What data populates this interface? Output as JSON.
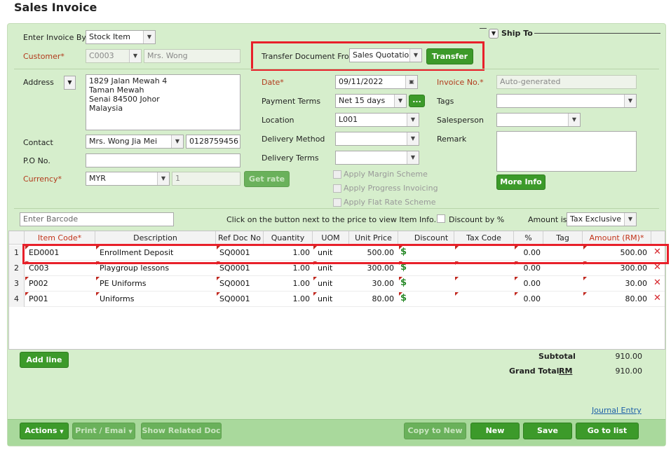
{
  "page": {
    "title": "Sales Invoice"
  },
  "header": {
    "enter_by_label": "Enter Invoice By",
    "enter_by_value": "Stock Item",
    "ship_to_label": "Ship To",
    "customer_label": "Customer*",
    "customer_code": "C0003",
    "customer_name": "Mrs. Wong",
    "transfer_label": "Transfer Document From",
    "transfer_value": "Sales Quotation",
    "transfer_button": "Transfer"
  },
  "left": {
    "address_label": "Address",
    "address_lines": [
      "1829 Jalan Mewah 4",
      "Taman Mewah",
      "Senai 84500 Johor",
      "Malaysia"
    ],
    "contact_label": "Contact",
    "contact_value": "Mrs. Wong Jia Mei",
    "phone_value": "0128759456",
    "po_label": "P.O No.",
    "po_value": "",
    "currency_label": "Currency*",
    "currency_value": "MYR",
    "rate_value": "1",
    "get_rate_button": "Get rate"
  },
  "middle": {
    "date_label": "Date*",
    "date_value": "09/11/2022",
    "payment_terms_label": "Payment Terms",
    "payment_terms_value": "Net 15 days",
    "more_button": "...",
    "location_label": "Location",
    "location_value": "L001",
    "delivery_method_label": "Delivery Method",
    "delivery_method_value": "",
    "delivery_terms_label": "Delivery Terms",
    "delivery_terms_value": "",
    "apply_margin": "Apply Margin Scheme",
    "apply_progress": "Apply Progress Invoicing",
    "apply_flat": "Apply Flat Rate Scheme"
  },
  "right": {
    "invoice_no_label": "Invoice No.*",
    "invoice_no_value": "Auto-generated",
    "tags_label": "Tags",
    "salesperson_label": "Salesperson",
    "remark_label": "Remark",
    "more_info_button": "More Info"
  },
  "toolbar": {
    "barcode_placeholder": "Enter Barcode",
    "hint": "Click on the button next to the price to view Item Info.",
    "discount_label": "Discount by %",
    "amount_is_label": "Amount is:",
    "amount_is_value": "Tax Exclusive"
  },
  "table": {
    "headers": [
      "Item Code*",
      "Description",
      "Ref Doc No",
      "Quantity",
      "UOM",
      "Unit Price",
      "Discount",
      "Tax Code",
      "%",
      "Tag",
      "Amount (RM)*"
    ],
    "rows": [
      {
        "n": "1",
        "code": "ED0001",
        "desc": "Enrollment Deposit",
        "ref": "SQ0001",
        "qty": "1.00",
        "uom": "unit",
        "price": "500.00",
        "pct": "0.00",
        "amount": "500.00"
      },
      {
        "n": "2",
        "code": "C003",
        "desc": "Playgroup lessons",
        "ref": "SQ0001",
        "qty": "1.00",
        "uom": "unit",
        "price": "300.00",
        "pct": "0.00",
        "amount": "300.00"
      },
      {
        "n": "3",
        "code": "P002",
        "desc": "PE Uniforms",
        "ref": "SQ0001",
        "qty": "1.00",
        "uom": "unit",
        "price": "30.00",
        "pct": "0.00",
        "amount": "30.00"
      },
      {
        "n": "4",
        "code": "P001",
        "desc": "Uniforms",
        "ref": "SQ0001",
        "qty": "1.00",
        "uom": "unit",
        "price": "80.00",
        "pct": "0.00",
        "amount": "80.00"
      }
    ]
  },
  "totals": {
    "add_line_button": "Add line",
    "subtotal_label": "Subtotal",
    "subtotal_value": "910.00",
    "grand_total_label": "Grand Total",
    "currency_link": "RM",
    "grand_total_value": "910.00",
    "journal_entry_link": "Journal Entry"
  },
  "footer": {
    "actions": "Actions",
    "print_email": "Print / Emai",
    "show_related": "Show Related Doc",
    "copy_to_new": "Copy to New",
    "new": "New",
    "save": "Save",
    "go_to_list": "Go to list"
  },
  "icons": {
    "dropdown": "chevron-down-icon",
    "calendar": "calendar-icon",
    "price_info": "dollar-icon",
    "delete": "close-icon"
  },
  "colors": {
    "panel": "#d6eecc",
    "button": "#3c9a2a",
    "highlight": "#e8202a",
    "required": "#b23a1c"
  }
}
